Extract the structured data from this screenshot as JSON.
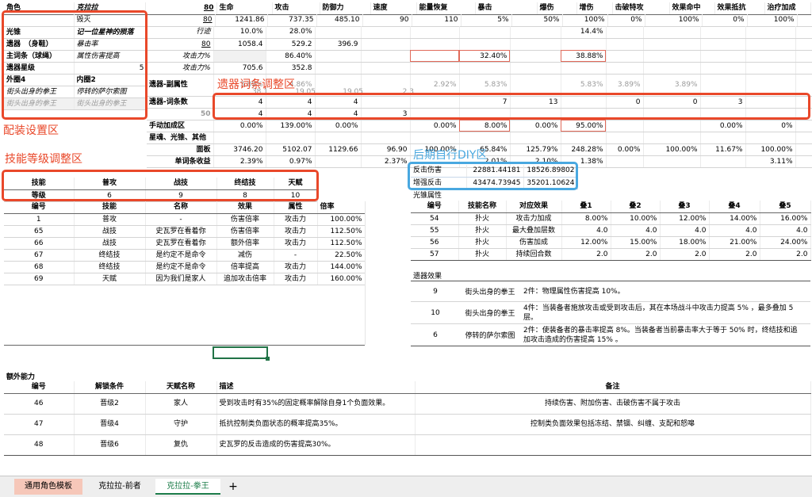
{
  "annotations": {
    "config_zone": "配装设置区",
    "skill_zone": "技能等级调整区",
    "relic_zone": "遗器词条调整区",
    "diy_zone": "后期自行DIY区"
  },
  "stats_header": [
    "生命",
    "攻击",
    "防御力",
    "速度",
    "能量恢复",
    "暴击",
    "爆伤",
    "增伤",
    "击破特攻",
    "效果命中",
    "效果抵抗",
    "治疗加成"
  ],
  "config": {
    "role_label": "角色",
    "role_name": "克拉拉",
    "role_path": "毁灭",
    "lc_label": "光锥",
    "lc_name": "记一位星神的殒落",
    "relic_label1": "遗器　（身鞋）",
    "relic_label1_val": "暴击率",
    "relic_label2": "主词条（球绳）",
    "relic_label2_val": "属性伤害提高",
    "relic_star_label": "遗器星级",
    "relic_star_val": "5",
    "outer_label": "外圈4",
    "inner_label": "内圈2",
    "outer_set": "街头出身的拳王",
    "inner_set": "停转的萨尔索图",
    "outer_set2": "街头出身的拳王",
    "inner_set2": "街头出身的拳王"
  },
  "rows": {
    "r1": {
      "vals": [
        "80",
        "1241.86",
        "737.35",
        "485.10",
        "90",
        "110",
        "5%",
        "50%",
        "100%",
        "0%",
        "100%",
        "0%",
        "100%"
      ]
    },
    "r2": {
      "label": "行迹",
      "vals": [
        "10.0%",
        "28.0%",
        "14.4%"
      ]
    },
    "r3": {
      "vals": [
        "80",
        "1058.4",
        "529.2",
        "396.9"
      ]
    },
    "r4": {
      "label": "攻击力%",
      "vals": [
        "86.40%",
        "32.40%",
        "38.88%"
      ]
    },
    "r5": {
      "label": "攻击力%",
      "vals": [
        "705.6",
        "352.8"
      ]
    },
    "r6": {
      "label": "遗器-副属性",
      "vals": [
        "3.89%",
        "4.86%",
        "2.92%",
        "5.83%",
        "5.83%",
        "3.89%",
        "3.89%"
      ],
      "sub": [
        "38.1",
        "19.05",
        "19.05",
        "2.3"
      ]
    },
    "r7": {
      "label": "遗器-词条数",
      "vals": [
        "4",
        "4",
        "4",
        "7",
        "13",
        "0",
        "0",
        "3"
      ]
    },
    "r8": {
      "vals": [
        "50",
        "4",
        "4",
        "4",
        "3"
      ]
    },
    "r9": {
      "label": "手动加成区",
      "vals": [
        "0.00%",
        "139.00%",
        "0.00%",
        "0.00%",
        "8.00%",
        "0.00%",
        "95.00%",
        "0.00%",
        "0%"
      ]
    },
    "r10": {
      "label": "星魂、光锥、其他"
    },
    "r11": {
      "label": "面板",
      "vals": [
        "3746.20",
        "5102.07",
        "1129.66",
        "96.90",
        "100.00%",
        "65.84%",
        "125.79%",
        "248.28%",
        "0.00%",
        "100.00%",
        "11.67%",
        "100.00%"
      ]
    },
    "r12": {
      "label": "单词条收益",
      "vals": [
        "2.39%",
        "0.97%",
        "2.37%",
        "2.01%",
        "2.10%",
        "1.38%",
        "3.11%"
      ]
    }
  },
  "skill_levels": {
    "headers": [
      "技能",
      "普攻",
      "战技",
      "终结技",
      "天赋"
    ],
    "label": "等级",
    "vals": [
      "6",
      "9",
      "8",
      "10"
    ]
  },
  "skills": {
    "headers": [
      "编号",
      "技能",
      "名称",
      "效果",
      "属性",
      "倍率"
    ],
    "rows": [
      [
        "1",
        "普攻",
        "-",
        "伤害倍率",
        "攻击力",
        "100.00%"
      ],
      [
        "65",
        "战技",
        "史瓦罗在看着你",
        "伤害倍率",
        "攻击力",
        "112.50%"
      ],
      [
        "66",
        "战技",
        "史瓦罗在看着你",
        "额外倍率",
        "攻击力",
        "112.50%"
      ],
      [
        "67",
        "终结技",
        "是约定不是命令",
        "减伤",
        "-",
        "22.50%"
      ],
      [
        "68",
        "终结技",
        "是约定不是命令",
        "倍率提高",
        "攻击力",
        "144.00%"
      ],
      [
        "69",
        "天赋",
        "因为我们是家人",
        "追加攻击倍率",
        "攻击力",
        "160.00%"
      ]
    ]
  },
  "diy": {
    "rows": [
      [
        "反击伤害",
        "22881.44181",
        "18526.89802"
      ],
      [
        "增强反击",
        "43474.73945",
        "35201.10624"
      ]
    ]
  },
  "lc_attr": {
    "title": "光锥属性",
    "headers": [
      "编号",
      "技能名称",
      "对应效果",
      "叠1",
      "叠2",
      "叠3",
      "叠4",
      "叠5"
    ],
    "rows": [
      [
        "54",
        "扑火",
        "攻击力加成",
        "8.00%",
        "10.00%",
        "12.00%",
        "14.00%",
        "16.00%"
      ],
      [
        "55",
        "扑火",
        "最大叠加层数",
        "4.0",
        "4.0",
        "4.0",
        "4.0",
        "4.0"
      ],
      [
        "56",
        "扑火",
        "伤害加成",
        "12.00%",
        "15.00%",
        "18.00%",
        "21.00%",
        "24.00%"
      ],
      [
        "57",
        "扑火",
        "持续回合数",
        "2.0",
        "2.0",
        "2.0",
        "2.0",
        "2.0"
      ]
    ]
  },
  "relic_effect": {
    "title": "遗器效果",
    "rows": [
      {
        "id": "9",
        "name": "街头出身的拳王",
        "desc": [
          "2件：物理属性伤害提高 10%。"
        ]
      },
      {
        "id": "10",
        "name": "街头出身的拳王",
        "desc": [
          "4件：当装备者施放攻击或受到攻击后，其在本场战斗中攻击力提高 5% ，最多叠加 5",
          "层。"
        ]
      },
      {
        "id": "6",
        "name": "停转的萨尔索图",
        "desc": [
          "2件：使装备者的暴击率提高 8%。当装备者当前暴击率大于等于 50% 时，终结技和追",
          "加攻击造成的伤害提高 15% 。"
        ]
      }
    ]
  },
  "extra": {
    "title": "额外能力",
    "headers": [
      "编号",
      "解锁条件",
      "天赋名称",
      "描述",
      "备注"
    ],
    "rows": [
      [
        "46",
        "晋级2",
        "家人",
        "受到攻击时有35%的固定概率解除自身1个负面效果。",
        "持续伤害、附加伤害、击破伤害不属于攻击"
      ],
      [
        "47",
        "晋级4",
        "守护",
        "抵抗控制类负面状态的概率提高35%。",
        "控制类负面效果包括冻结、禁锢、纠缠、支配和怒嗥"
      ],
      [
        "48",
        "晋级6",
        "复仇",
        "史瓦罗的反击造成的伤害提高30%。",
        ""
      ]
    ]
  },
  "tabs": [
    "通用角色模板",
    "克拉拉-前者",
    "克拉拉-拳王",
    "+"
  ]
}
